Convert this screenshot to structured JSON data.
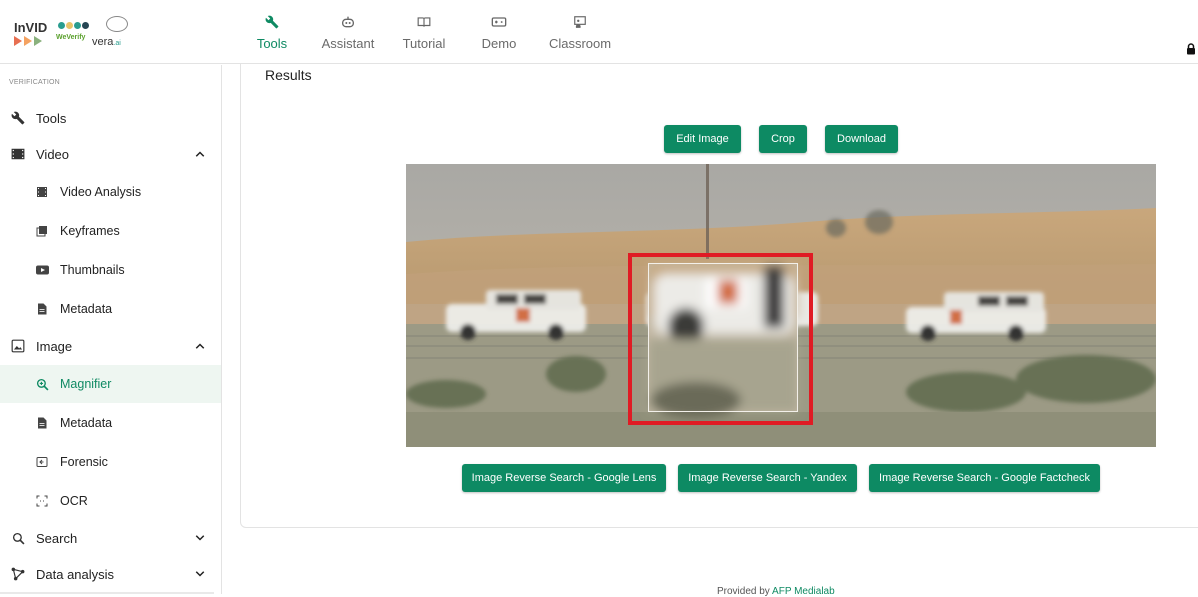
{
  "header": {
    "logos": {
      "invid": "InVID",
      "weverify": "WeVerify",
      "vera": "vera",
      "vera_suffix": ".ai"
    },
    "nav_tabs": [
      {
        "label": "Tools",
        "icon": "wrench-icon",
        "active": true
      },
      {
        "label": "Assistant",
        "icon": "robot-icon",
        "active": false
      },
      {
        "label": "Tutorial",
        "icon": "book-icon",
        "active": false
      },
      {
        "label": "Demo",
        "icon": "gamepad-icon",
        "active": false
      },
      {
        "label": "Classroom",
        "icon": "classroom-icon",
        "active": false
      }
    ],
    "lock_icon": "lock-icon"
  },
  "sidebar": {
    "section_label": "VERIFICATION",
    "items": [
      {
        "label": "Tools",
        "icon": "wrench-icon",
        "level": "top"
      },
      {
        "label": "Video",
        "icon": "film-icon",
        "level": "top",
        "expanded": true
      },
      {
        "label": "Video Analysis",
        "icon": "film-strip-icon",
        "level": "sub"
      },
      {
        "label": "Keyframes",
        "icon": "keyframes-icon",
        "level": "sub"
      },
      {
        "label": "Thumbnails",
        "icon": "youtube-icon",
        "level": "sub"
      },
      {
        "label": "Metadata",
        "icon": "document-icon",
        "level": "sub"
      },
      {
        "label": "Image",
        "icon": "image-icon",
        "level": "top",
        "expanded": true
      },
      {
        "label": "Magnifier",
        "icon": "magnifier-icon",
        "level": "sub",
        "selected": true
      },
      {
        "label": "Metadata",
        "icon": "document-icon",
        "level": "sub"
      },
      {
        "label": "Forensic",
        "icon": "forensic-icon",
        "level": "sub"
      },
      {
        "label": "OCR",
        "icon": "ocr-icon",
        "level": "sub"
      },
      {
        "label": "Search",
        "icon": "search-icon",
        "level": "top",
        "expanded": false
      },
      {
        "label": "Data analysis",
        "icon": "graph-icon",
        "level": "top",
        "expanded": false
      }
    ]
  },
  "main": {
    "results_title": "Results",
    "top_buttons": [
      "Edit Image",
      "Crop",
      "Download"
    ],
    "bottom_buttons": [
      "Image Reverse Search - Google Lens",
      "Image Reverse Search - Yandex",
      "Image Reverse Search - Google Factcheck"
    ],
    "magnifier_frame_color": "#e01b24",
    "accent_color": "#0d8a63"
  },
  "footer": {
    "provided_by": "Provided by",
    "brand": "AFP Medialab"
  }
}
